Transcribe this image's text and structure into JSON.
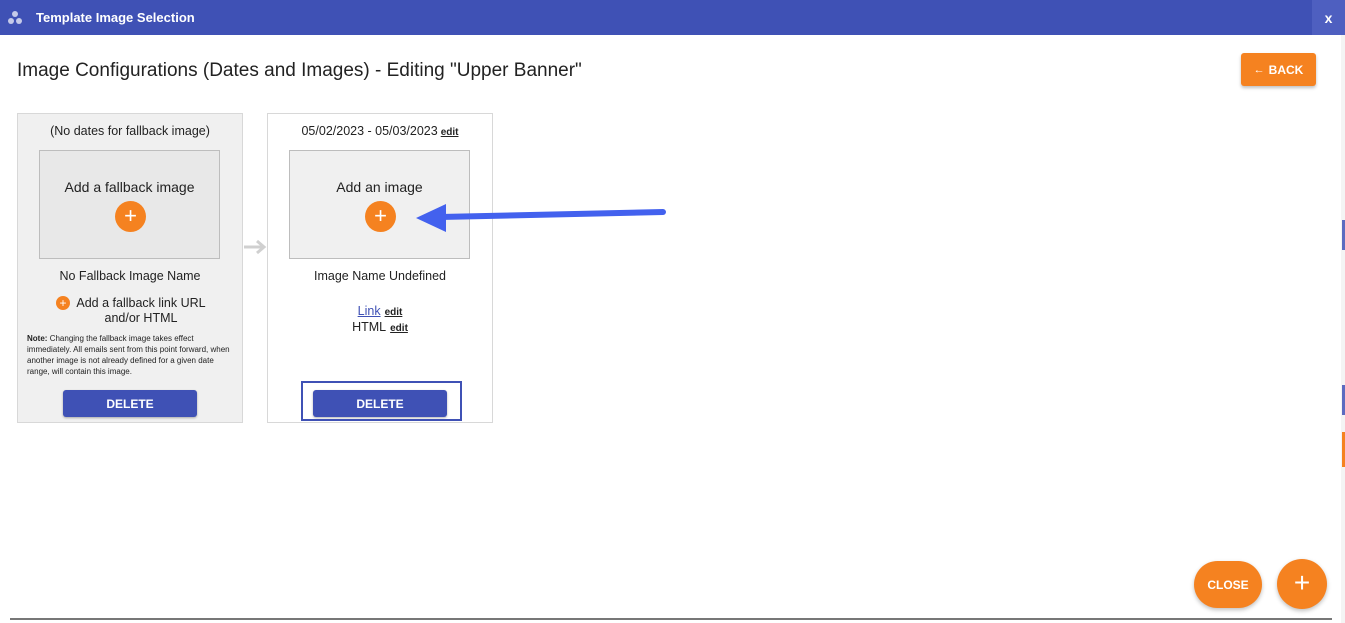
{
  "window": {
    "title": "Template Image Selection",
    "close_label": "x"
  },
  "page": {
    "title": "Image Configurations (Dates and Images) - Editing \"Upper Banner\"",
    "back_label": "BACK"
  },
  "fallback_card": {
    "header": "(No dates for fallback image)",
    "image_box_label": "Add a fallback image",
    "image_name": "No Fallback Image Name",
    "add_link_label": "Add a fallback link URL and/or HTML",
    "note_label": "Note:",
    "note_text": "Changing the fallback image takes effect immediately. All emails sent from this point forward, when another image is not already defined for a given date range, will contain this image.",
    "delete_label": "DELETE"
  },
  "dated_card": {
    "date_range": "05/02/2023 - 05/03/2023",
    "date_edit_label": "edit",
    "image_box_label": "Add an image",
    "image_name": "Image Name Undefined",
    "link_label": "Link",
    "link_edit_label": "edit",
    "html_label": "HTML",
    "html_edit_label": "edit",
    "delete_label": "DELETE"
  },
  "footer": {
    "close_label": "CLOSE",
    "add_label": "+"
  },
  "colors": {
    "primary": "#3f51b5",
    "accent": "#f58220",
    "annotation_arrow": "#4361ee"
  }
}
